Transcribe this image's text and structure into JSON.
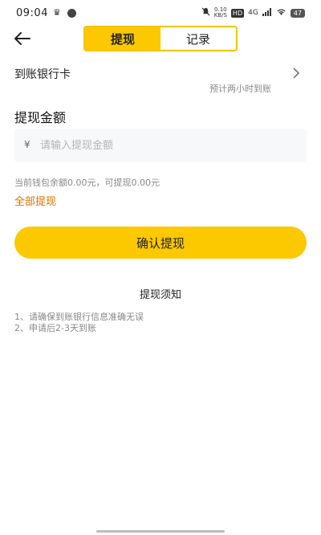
{
  "status_bar": {
    "time": "09:04",
    "speed_value": "0.10",
    "speed_unit": "KB/S",
    "hd": "HD",
    "network": "4G",
    "battery": "47"
  },
  "header": {
    "tabs": [
      {
        "label": "提现",
        "active": true
      },
      {
        "label": "记录",
        "active": false
      }
    ]
  },
  "bank": {
    "label": "到账银行卡",
    "sub": "预计两小时到账"
  },
  "amount": {
    "title": "提现金额",
    "currency": "¥",
    "placeholder": "请输入提现金额",
    "value": ""
  },
  "balance": {
    "text": "当前钱包余额0.00元，可提现0.00元",
    "withdraw_all": "全部提现"
  },
  "confirm_label": "确认提现",
  "notice": {
    "title": "提现须知",
    "items": [
      "1、请确保到账银行信息准确无误",
      "2、申请后2-3天到账"
    ]
  },
  "colors": {
    "accent": "#fcc800",
    "orange_link": "#e07000"
  }
}
